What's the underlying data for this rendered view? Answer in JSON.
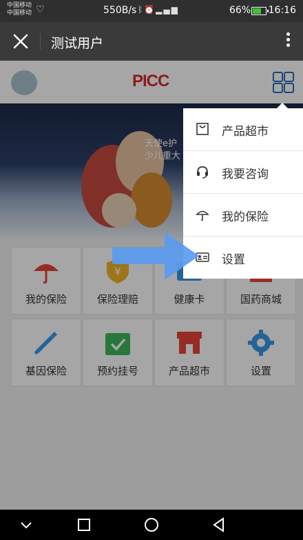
{
  "status_bar": {
    "carrier_1": "中国移动",
    "carrier_2": "中国移动",
    "speed": "550B/s",
    "battery": "66%",
    "time": "16:16"
  },
  "nav": {
    "title": "测试用户"
  },
  "app": {
    "brand": "PICC",
    "banner": {
      "line_1": "天使e护",
      "line_2": "少儿重大"
    },
    "tiles": [
      {
        "label": "我的保险",
        "icon": "umbrella-icon"
      },
      {
        "label": "保险理赔",
        "icon": "shield-yen-icon"
      },
      {
        "label": "健康卡",
        "icon": "health-card-icon"
      },
      {
        "label": "国药商城",
        "icon": "mall-icon"
      },
      {
        "label": "基因保险",
        "icon": "dropper-icon"
      },
      {
        "label": "预约挂号",
        "icon": "calendar-check-icon"
      },
      {
        "label": "产品超市",
        "icon": "store-icon"
      },
      {
        "label": "设置",
        "icon": "gear-icon"
      }
    ]
  },
  "menu": {
    "items": [
      {
        "label": "产品超市",
        "icon": "bag-icon"
      },
      {
        "label": "我要咨询",
        "icon": "headset-icon"
      },
      {
        "label": "我的保险",
        "icon": "umbrella-icon"
      },
      {
        "label": "设置",
        "icon": "id-card-icon"
      }
    ]
  },
  "colors": {
    "accent": "#2a6db4",
    "brand_red": "#d8282b",
    "arrow_blue": "#5a9bf0"
  }
}
